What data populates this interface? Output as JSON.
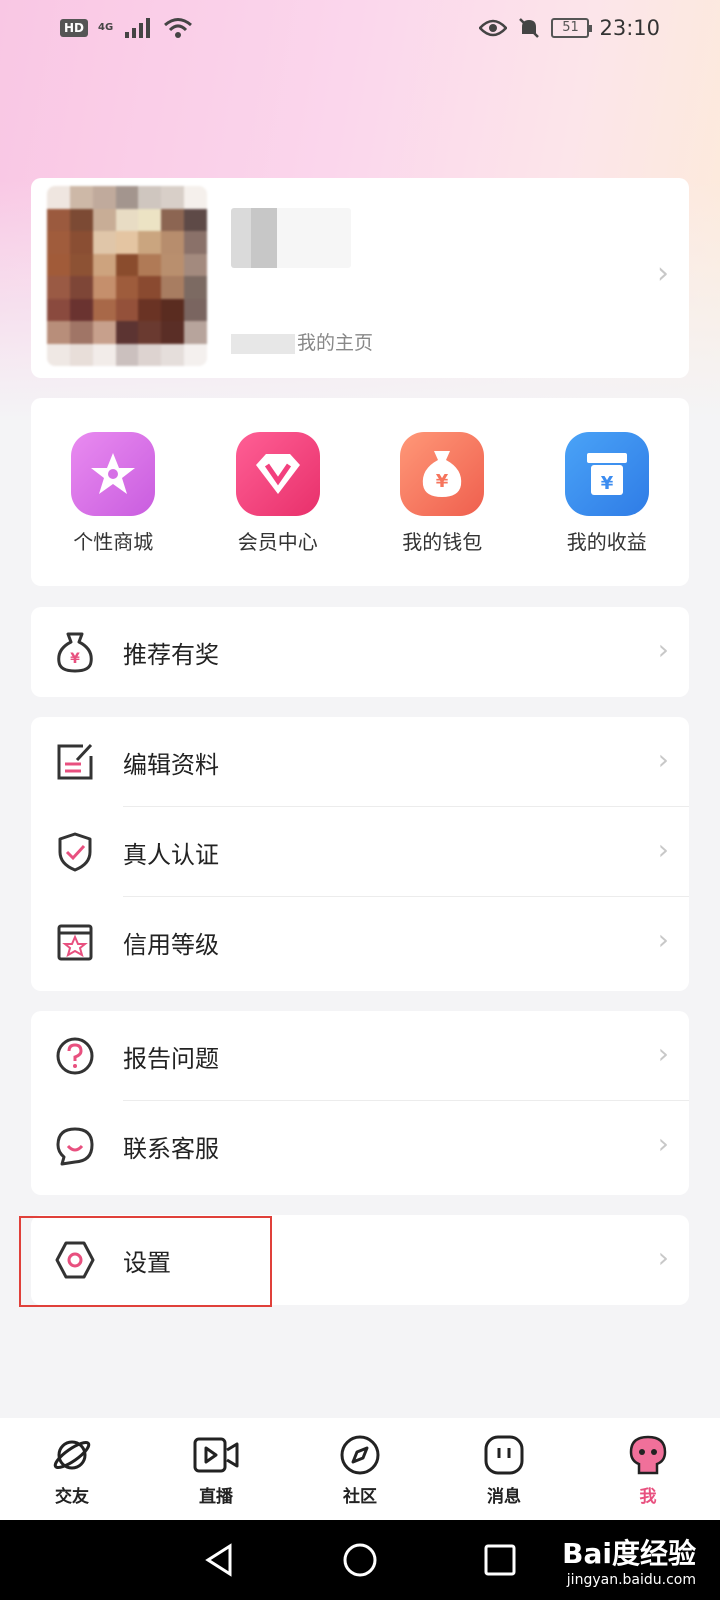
{
  "status_bar": {
    "hd": "HD",
    "network": "4G",
    "battery": "51",
    "time": "23:10"
  },
  "profile": {
    "homepage_link": "我的主页"
  },
  "quick_actions": [
    {
      "label": "个性商城",
      "icon": "star-icon",
      "color": "#d96ae6"
    },
    {
      "label": "会员中心",
      "icon": "diamond-v-icon",
      "color": "#f2407e"
    },
    {
      "label": "我的钱包",
      "icon": "money-bag-icon",
      "color": "#f6745c"
    },
    {
      "label": "我的收益",
      "icon": "income-box-icon",
      "color": "#3b8cf0"
    }
  ],
  "menu": {
    "referral": "推荐有奖",
    "edit_profile": "编辑资料",
    "verification": "真人认证",
    "credit_level": "信用等级",
    "report_issue": "报告问题",
    "contact_support": "联系客服",
    "settings": "设置"
  },
  "bottom_nav": [
    {
      "label": "交友",
      "icon": "planet-icon"
    },
    {
      "label": "直播",
      "icon": "video-icon"
    },
    {
      "label": "社区",
      "icon": "compass-icon"
    },
    {
      "label": "消息",
      "icon": "message-icon"
    },
    {
      "label": "我",
      "icon": "profile-mascot-icon",
      "active": true
    }
  ],
  "watermark": {
    "logo": "Bai度经验",
    "url": "jingyan.baidu.com"
  },
  "colors": {
    "accent": "#e8507f",
    "highlight_box": "#e0403a"
  }
}
